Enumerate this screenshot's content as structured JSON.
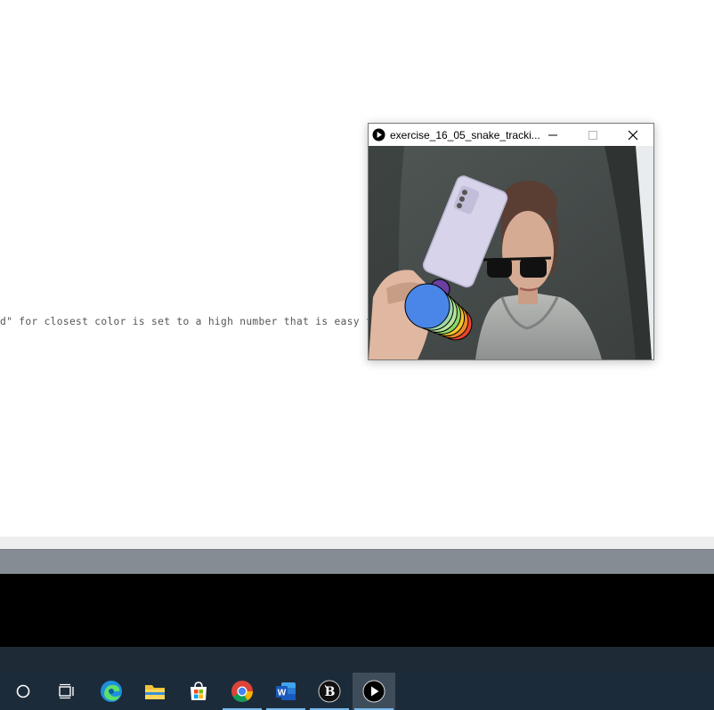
{
  "editor": {
    "visible_code_fragment": "d\" for closest color is set to a high number that is easy fo"
  },
  "sketch_window": {
    "title": "exercise_16_05_snake_tracki...",
    "trail_colors": [
      "#e8432e",
      "#f08a24",
      "#f4c430",
      "#8ad66b",
      "#b7e39a",
      "#9fd8a8",
      "#4a86e8"
    ],
    "tracked_color_marker": "#6b3fa0"
  },
  "taskbar": {
    "items": [
      {
        "name": "cortana-search",
        "icon": "circle-icon"
      },
      {
        "name": "task-view",
        "icon": "task-view-icon"
      },
      {
        "name": "microsoft-edge",
        "icon": "edge-icon"
      },
      {
        "name": "file-explorer",
        "icon": "folder-icon"
      },
      {
        "name": "microsoft-store",
        "icon": "store-icon"
      },
      {
        "name": "google-chrome",
        "icon": "chrome-icon"
      },
      {
        "name": "microsoft-word",
        "icon": "word-icon"
      },
      {
        "name": "processing-ide",
        "icon": "processing-icon"
      },
      {
        "name": "sketch-window",
        "icon": "play-icon"
      }
    ],
    "colors": {
      "background": "#1c2b3a",
      "indicator": "#76b9ed",
      "active": "#3f4d5b"
    }
  }
}
